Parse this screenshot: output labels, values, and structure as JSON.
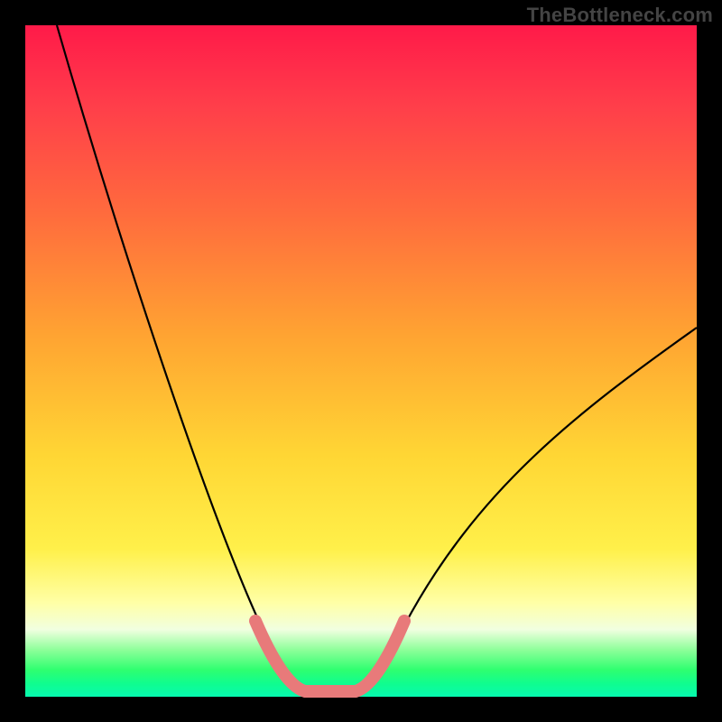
{
  "watermark": "TheBottleneck.com",
  "chart_data": {
    "type": "line",
    "title": "",
    "xlabel": "",
    "ylabel": "",
    "xlim": [
      0,
      1
    ],
    "ylim": [
      0,
      1
    ],
    "series": [
      {
        "name": "curve",
        "x": [
          0.0,
          0.05,
          0.1,
          0.15,
          0.2,
          0.25,
          0.3,
          0.35,
          0.38,
          0.41,
          0.44,
          0.47,
          0.5,
          0.53,
          0.6,
          0.7,
          0.8,
          0.9,
          1.0
        ],
        "values": [
          1.0,
          0.86,
          0.72,
          0.59,
          0.47,
          0.36,
          0.25,
          0.13,
          0.06,
          0.02,
          0.0,
          0.0,
          0.02,
          0.06,
          0.15,
          0.27,
          0.37,
          0.46,
          0.53
        ],
        "stroke": "#000000"
      },
      {
        "name": "highlight-band",
        "x": [
          0.345,
          0.365,
          0.385,
          0.405,
          0.425,
          0.445,
          0.465,
          0.485,
          0.505,
          0.525,
          0.545
        ],
        "values": [
          0.095,
          0.055,
          0.025,
          0.006,
          0.0,
          0.0,
          0.0,
          0.006,
          0.025,
          0.055,
          0.095
        ],
        "stroke": "#e87a7a"
      }
    ]
  },
  "colors": {
    "highlight": "#e87a7a",
    "curve": "#000000"
  }
}
